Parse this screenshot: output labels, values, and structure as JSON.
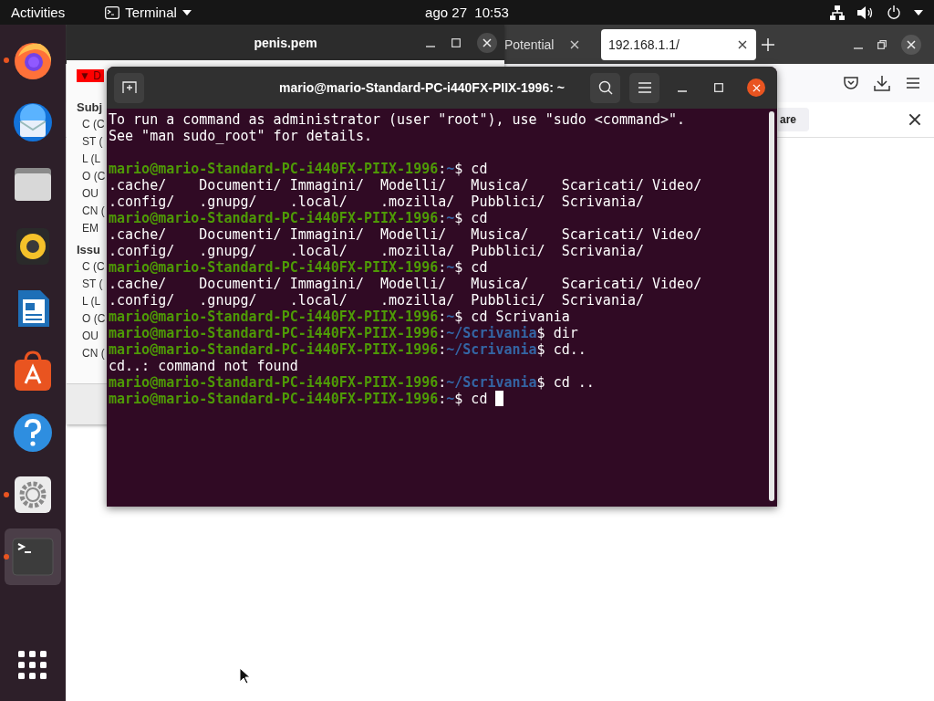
{
  "top_bar": {
    "activities": "Activities",
    "app_menu": "Terminal",
    "clock": "ago 27  10:53"
  },
  "dock": [
    {
      "kind": "firefox",
      "running": true,
      "selected": false
    },
    {
      "kind": "thunderbird",
      "running": false,
      "selected": false
    },
    {
      "kind": "files",
      "running": false,
      "selected": false
    },
    {
      "kind": "rhythmbox",
      "running": false,
      "selected": false
    },
    {
      "kind": "writer",
      "running": false,
      "selected": false
    },
    {
      "kind": "store",
      "running": false,
      "selected": false
    },
    {
      "kind": "help",
      "running": false,
      "selected": false
    },
    {
      "kind": "settings",
      "running": true,
      "selected": false
    },
    {
      "kind": "terminal",
      "running": true,
      "selected": true
    }
  ],
  "browser": {
    "tabs": [
      {
        "label": "Potential",
        "selected": false
      },
      {
        "label": "192.168.1.1/",
        "selected": true
      }
    ],
    "find_bar": {
      "button": "are"
    }
  },
  "certificate_window": {
    "title": "penis.pem",
    "badge": "▼ D",
    "sections": [
      {
        "heading": "Subj",
        "fields": [
          "C (C",
          "ST (",
          "L (L",
          "O (C",
          "OU",
          "CN (",
          "EM"
        ]
      },
      {
        "heading": "Issu",
        "fields": [
          "C (C",
          "ST (",
          "L (L",
          "O (C",
          "OU",
          "CN ("
        ]
      }
    ]
  },
  "terminal": {
    "title": "mario@mario-Standard-PC-i440FX-PIIX-1996: ~",
    "separator": ":",
    "lines": [
      {
        "kind": "text",
        "text": "To run a command as administrator (user \"root\"), use \"sudo <command>\"."
      },
      {
        "kind": "text",
        "text": "See \"man sudo_root\" for details."
      },
      {
        "kind": "blank"
      },
      {
        "kind": "prompt",
        "user": "mario@mario-Standard-PC-i440FX-PIIX-1996",
        "path": "~",
        "command": "$ cd"
      },
      {
        "kind": "text",
        "text": ".cache/    Documenti/ Immagini/  Modelli/   Musica/    Scaricati/ Video/"
      },
      {
        "kind": "text",
        "text": ".config/   .gnupg/    .local/    .mozilla/  Pubblici/  Scrivania/"
      },
      {
        "kind": "prompt",
        "user": "mario@mario-Standard-PC-i440FX-PIIX-1996",
        "path": "~",
        "command": "$ cd"
      },
      {
        "kind": "text",
        "text": ".cache/    Documenti/ Immagini/  Modelli/   Musica/    Scaricati/ Video/"
      },
      {
        "kind": "text",
        "text": ".config/   .gnupg/    .local/    .mozilla/  Pubblici/  Scrivania/"
      },
      {
        "kind": "prompt",
        "user": "mario@mario-Standard-PC-i440FX-PIIX-1996",
        "path": "~",
        "command": "$ cd"
      },
      {
        "kind": "text",
        "text": ".cache/    Documenti/ Immagini/  Modelli/   Musica/    Scaricati/ Video/"
      },
      {
        "kind": "text",
        "text": ".config/   .gnupg/    .local/    .mozilla/  Pubblici/  Scrivania/"
      },
      {
        "kind": "prompt",
        "user": "mario@mario-Standard-PC-i440FX-PIIX-1996",
        "path": "~",
        "command": "$ cd Scrivania"
      },
      {
        "kind": "prompt",
        "user": "mario@mario-Standard-PC-i440FX-PIIX-1996",
        "path": "~/Scrivania",
        "command": "$ dir"
      },
      {
        "kind": "prompt",
        "user": "mario@mario-Standard-PC-i440FX-PIIX-1996",
        "path": "~/Scrivania",
        "command": "$ cd.."
      },
      {
        "kind": "text",
        "text": "cd..: command not found"
      },
      {
        "kind": "prompt",
        "user": "mario@mario-Standard-PC-i440FX-PIIX-1996",
        "path": "~/Scrivania",
        "command": "$ cd .."
      },
      {
        "kind": "prompt",
        "user": "mario@mario-Standard-PC-i440FX-PIIX-1996",
        "path": "~",
        "command": "$ cd ",
        "cursor": true
      }
    ]
  }
}
